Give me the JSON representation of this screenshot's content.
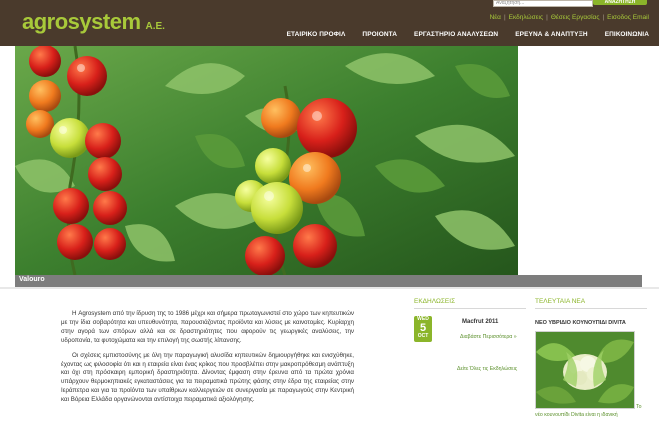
{
  "header": {
    "logo_text": "agrosystem",
    "logo_suffix": "A.E.",
    "search_placeholder": "Αναζήτηση...",
    "search_button": "ΑΝΑΖΗΤΗΣΗ",
    "top_links": [
      "Νέα",
      "Εκδηλώσεις",
      "Θέσεις Εργασίας",
      "Εισοδος Email"
    ],
    "nav": [
      "ΕΤΑΙΡΙΚΟ ΠΡΟΦΙΛ",
      "ΠΡΟΙΟΝΤΑ",
      "ΕΡΓΑΣΤΗΡΙΟ ΑΝΑΛΥΣΕΩΝ",
      "ΕΡΕΥΝΑ & ΑΝΑΠΤΥΞΗ",
      "ΕΠΙΚΟΙΝΩΝΙΑ"
    ]
  },
  "hero": {
    "caption": "Valouro"
  },
  "intro": {
    "p1": "Η Agrosystem από την ίδρυση της το 1986 μέχρι και σήμερα πρωταγωνιστεί στο χώρο των κηπευτικών με την ίδια σοβαρότητα και υπευθυνότητα, παρουσιάζοντας προϊόντα και λύσεις με καινοτομίες. Κυρίαρχη στην αγορά των σπόρων αλλά και σε δραστηριότητες που αφορούν τις γεωργικές αναλύσεις, την υδροπονία, τα φυτοχώματα και την επιλογή της σωστής λίπανσης.",
    "p2": "Οι σχέσεις εμπιστοσύνης με όλη την παραγωγική αλυσίδα κηπευτικών δημιουργήθηκε και ενισχύθηκε, έχοντας ως φιλοσοφία ότι και η εταιρεία είναι ένας κρίκος που προσβλέπει στην μακροπρόθεσμη ανάπτυξη και όχι στη πρόσκαιρη εμπορική δραστηριότητα. Δίνοντας έμφαση στην έρευνα από τα πρώτα χρόνια υπάρχουν θερμοκηπιακές εγκαταστάσεις για τα πειραματικά πρώτης φάσης στην έδρα της εταιρείας στην Ιεράπετρα και για τα προϊόντα των υπαίθριων καλλιεργειών σε συνεργασία με παραγωγούς στην Κεντρική και Βόρεια Ελλάδα οργανώνονται αντίστοιχα πειραματικά αξιολόγησης."
  },
  "events": {
    "title": "ΕΚΔΗΛΩΣΕΙΣ",
    "date_weekday": "WED",
    "date_day": "5",
    "date_month": "OCT",
    "item_title": "Macfrut 2011",
    "read_more": "Διαβάστε Περισσότερα »",
    "all_link": "Δείτε Όλες τις Εκδηλώσεις"
  },
  "news": {
    "title": "ΤΕΛΕΥΤΑΙΑ ΝΕΑ",
    "headline": "ΝΕΟ ΥΒΡΙΔΙΟ ΚΟΥΝΟΥΠΙΔΙ DIVITA",
    "more": "Το",
    "desc": "νέο κουνουπίδι Divita είναι η ιδανική"
  }
}
